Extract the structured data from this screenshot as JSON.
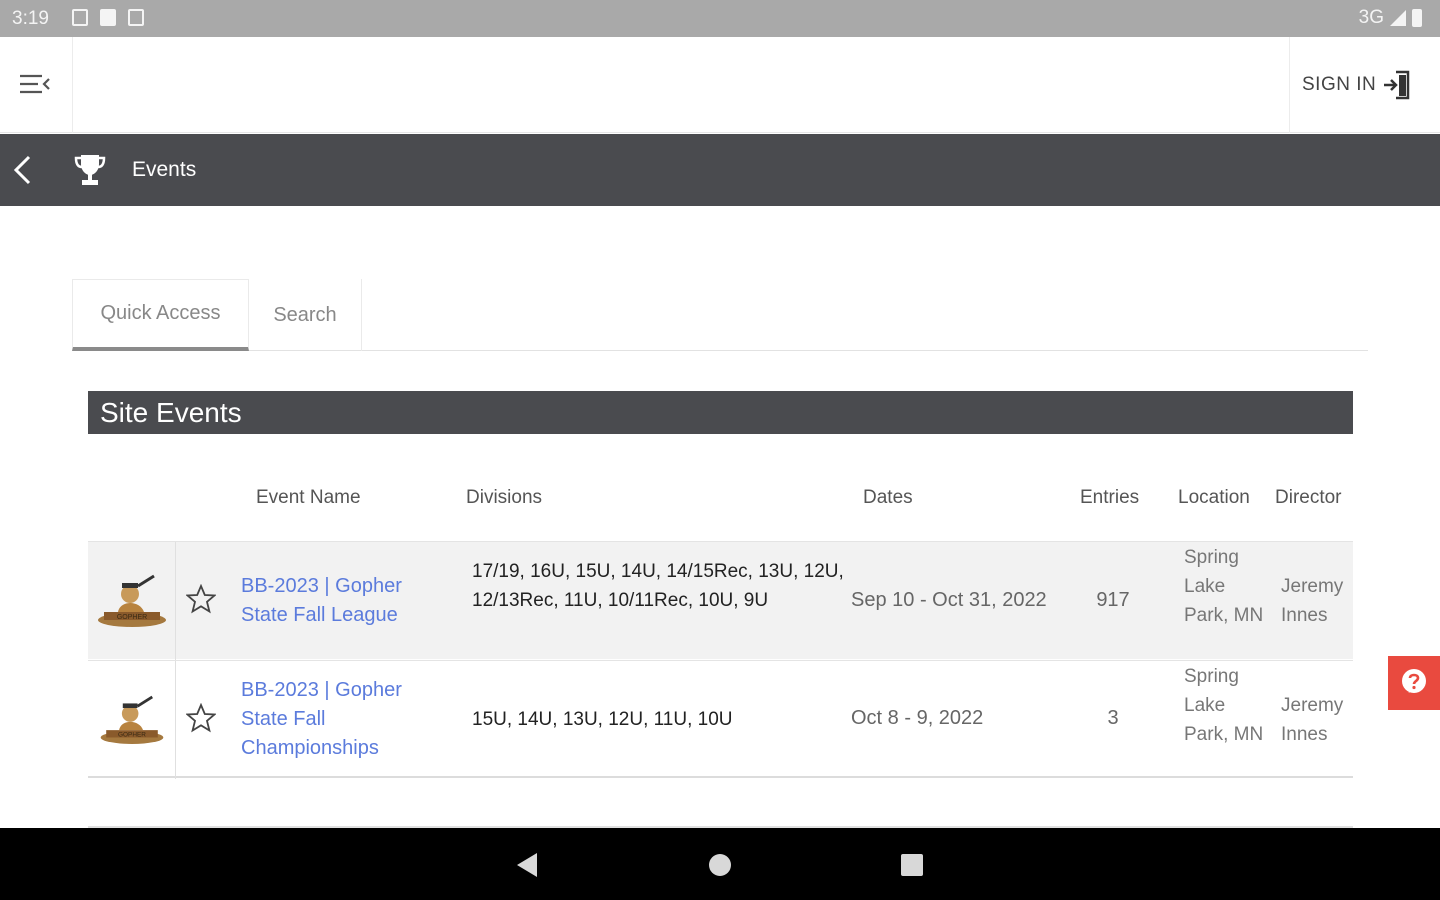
{
  "status_bar": {
    "time": "3:19",
    "network": "3G"
  },
  "header": {
    "signin_label": "SIGN IN"
  },
  "nav": {
    "title": "Events"
  },
  "tabs": [
    {
      "label": "Quick Access",
      "active": true
    },
    {
      "label": "Search",
      "active": false
    }
  ],
  "section": {
    "title": "Site Events"
  },
  "table": {
    "columns": {
      "name": "Event Name",
      "divisions": "Divisions",
      "dates": "Dates",
      "entries": "Entries",
      "location": "Location",
      "director": "Director"
    },
    "rows": [
      {
        "name": "BB-2023 | Gopher State Fall League",
        "divisions": "17/19, 16U, 15U, 14U, 14/15Rec, 13U, 12U, 12/13Rec, 11U, 10/11Rec, 10U, 9U",
        "dates": "Sep 10 - Oct 31, 2022",
        "entries": "917",
        "location": "Spring Lake Park, MN",
        "director": "Jeremy Innes"
      },
      {
        "name": "BB-2023 | Gopher State Fall Championships",
        "divisions": "15U, 14U, 13U, 12U, 11U, 10U",
        "dates": "Oct 8 - 9, 2022",
        "entries": "3",
        "location": "Spring Lake Park, MN",
        "director": "Jeremy Innes"
      }
    ]
  },
  "colors": {
    "dark_bar": "#4a4b4f",
    "link": "#5b7bdc",
    "help": "#e94a3f"
  },
  "icons": [
    "menu-icon",
    "sign-in-icon",
    "back-arrow-icon",
    "trophy-icon",
    "star-icon",
    "help-icon",
    "nav-back-icon",
    "nav-home-icon",
    "nav-recents-icon"
  ]
}
